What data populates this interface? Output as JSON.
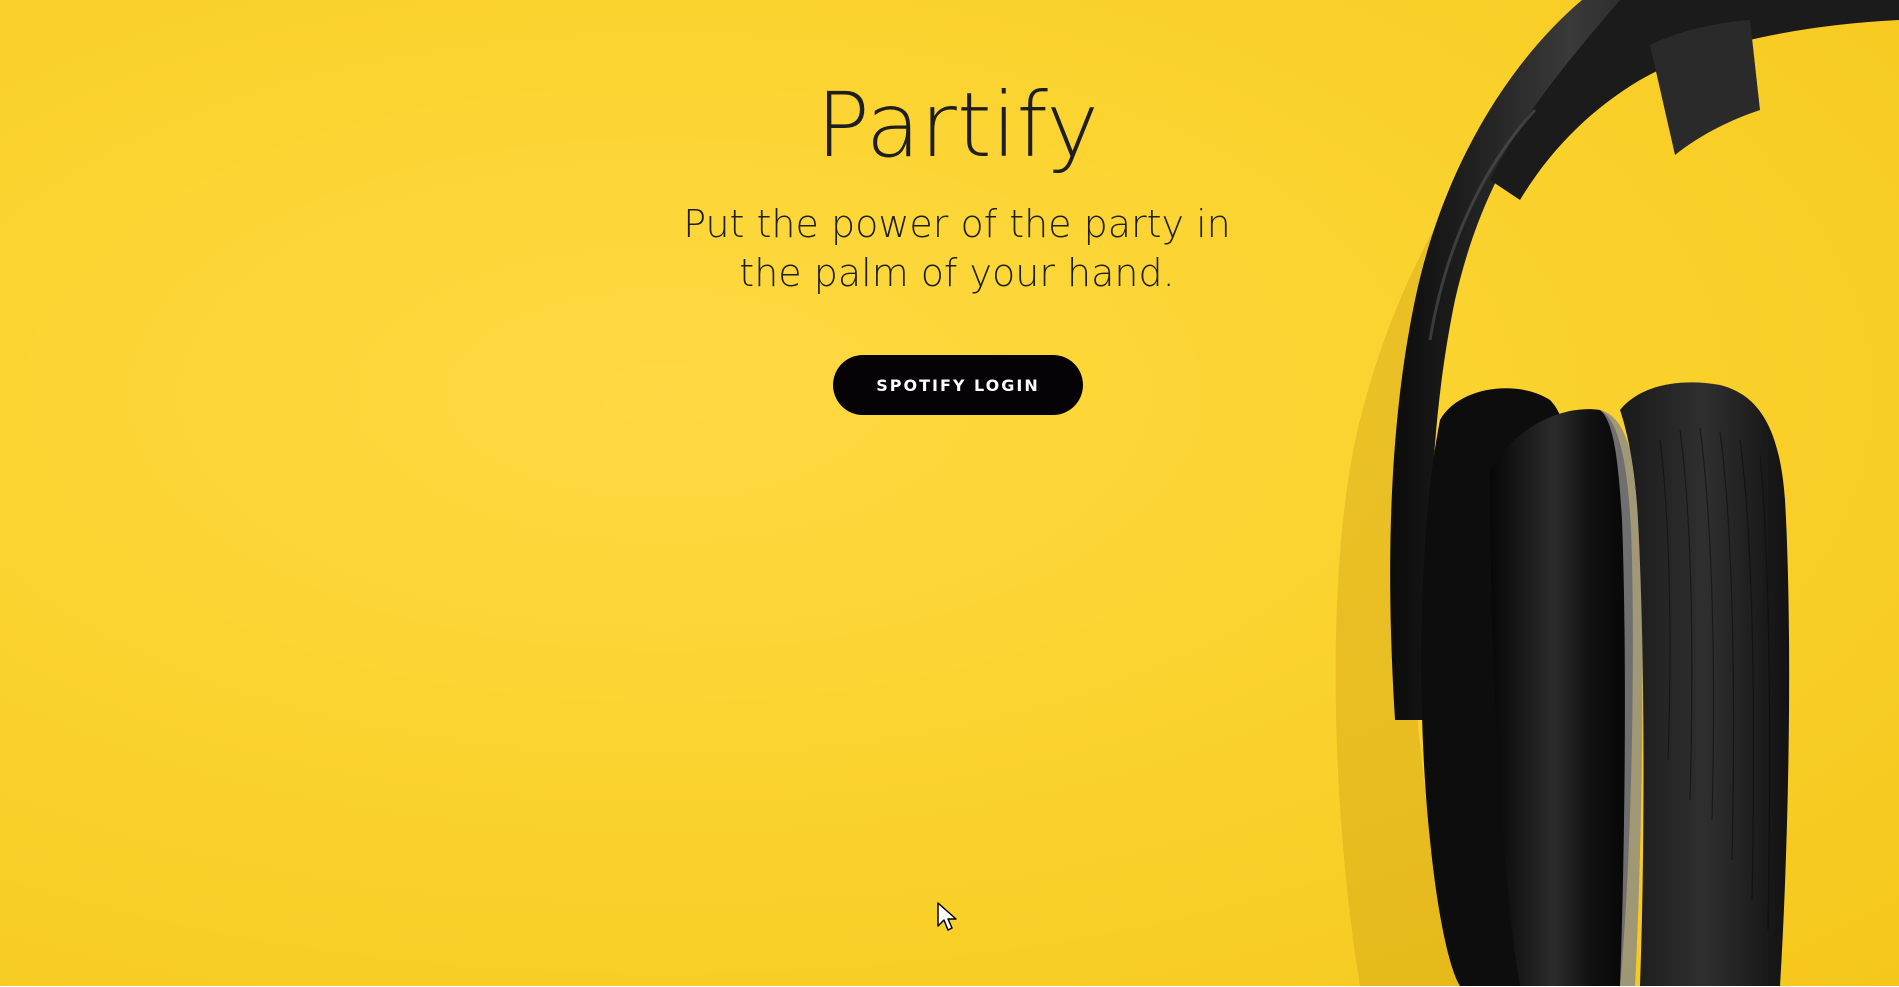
{
  "app": {
    "title": "Partify",
    "tagline": "Put the power of the party in the palm of your hand."
  },
  "actions": {
    "login_label": "SPOTIFY LOGIN"
  },
  "colors": {
    "background": "#fbd32f",
    "button": "#060306",
    "button_text": "#ffffff",
    "text": "#1e1e1e"
  },
  "icons": {
    "cursor": "pointer-cursor-icon",
    "headphones": "headphones-image"
  }
}
